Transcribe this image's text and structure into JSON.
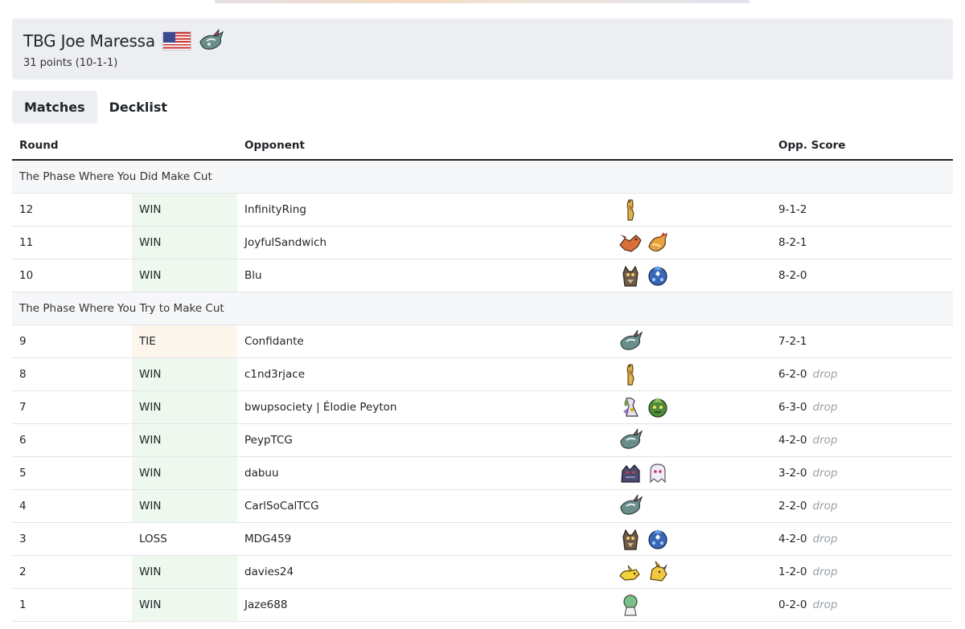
{
  "player": {
    "name": "TBG Joe Maressa",
    "flag_icon": "us-flag-icon",
    "deck_icon": "dragapult-icon",
    "points": "31 points (10-1-1)"
  },
  "tabs": [
    {
      "label": "Matches",
      "active": true
    },
    {
      "label": "Decklist",
      "active": false
    }
  ],
  "table": {
    "headers": {
      "round": "Round",
      "opponent": "Opponent",
      "score": "Opp. Score"
    },
    "phase1": {
      "label": "The Phase Where You Did Make Cut"
    },
    "phase2": {
      "label": "The Phase Where You Try to Make Cut"
    },
    "rows": [
      {
        "round": "12",
        "result": "WIN",
        "opponent": "InfinityRing",
        "deck": [
          "giraffe-icon"
        ],
        "score": "9-1-2",
        "drop": ""
      },
      {
        "round": "11",
        "result": "WIN",
        "opponent": "JoyfulSandwich",
        "deck": [
          "charizard-icon",
          "pidgeot-icon"
        ],
        "score": "8-2-1",
        "drop": ""
      },
      {
        "round": "10",
        "result": "WIN",
        "opponent": "Blu",
        "deck": [
          "owl-icon",
          "blue-mask-icon"
        ],
        "score": "8-2-0",
        "drop": ""
      },
      {
        "round": "9",
        "result": "TIE",
        "opponent": "Confidante",
        "deck": [
          "dragapult-icon"
        ],
        "score": "7-2-1",
        "drop": ""
      },
      {
        "round": "8",
        "result": "WIN",
        "opponent": "c1nd3rjace",
        "deck": [
          "giraffe-icon"
        ],
        "score": "6-2-0",
        "drop": "drop"
      },
      {
        "round": "7",
        "result": "WIN",
        "opponent": "bwupsociety | Élodie Peyton",
        "deck": [
          "gardevoir-icon",
          "green-mask-icon"
        ],
        "score": "6-3-0",
        "drop": "drop"
      },
      {
        "round": "6",
        "result": "WIN",
        "opponent": "PeypTCG",
        "deck": [
          "dragapult-icon"
        ],
        "score": "4-2-0",
        "drop": "drop"
      },
      {
        "round": "5",
        "result": "WIN",
        "opponent": "dabuu",
        "deck": [
          "dark-beast-icon",
          "ghost-icon"
        ],
        "score": "3-2-0",
        "drop": "drop"
      },
      {
        "round": "4",
        "result": "WIN",
        "opponent": "CarlSoCalTCG",
        "deck": [
          "dragapult-icon"
        ],
        "score": "2-2-0",
        "drop": "drop"
      },
      {
        "round": "3",
        "result": "LOSS",
        "opponent": "MDG459",
        "deck": [
          "owl-icon",
          "blue-mask-icon"
        ],
        "score": "4-2-0",
        "drop": "drop"
      },
      {
        "round": "2",
        "result": "WIN",
        "opponent": "davies24",
        "deck": [
          "pikachu-icon",
          "raichu-icon"
        ],
        "score": "1-2-0",
        "drop": "drop"
      },
      {
        "round": "1",
        "result": "WIN",
        "opponent": "Jaze688",
        "deck": [
          "ralts-icon"
        ],
        "score": "0-2-0",
        "drop": "drop"
      }
    ]
  },
  "colors": {
    "win_bg": "#eef8ee",
    "tie_bg": "#fcf6ec",
    "card_bg": "#eceef2",
    "drop_text": "#9aa0a6"
  }
}
